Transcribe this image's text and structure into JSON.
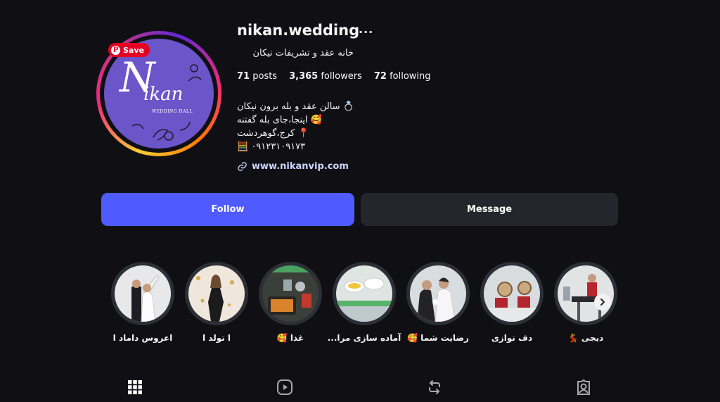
{
  "save_button": {
    "label": "Save"
  },
  "profile": {
    "username": "nikan.wedding",
    "category": "خانه عقد و تشریفات نیکان",
    "posts_count": "71",
    "posts_label": "posts",
    "followers_count": "3,365",
    "followers_label": "followers",
    "following_count": "72",
    "following_label": "following",
    "bio": [
      "💍 سالن عقد و بله برون نیکان",
      "🥰 اینجا،جای بله گفتنه",
      "📍 کرج،گوهردشت",
      "🧮 ۰۹۱۲۳۱۰۹۱۷۳"
    ],
    "link": "www.nikanvip.com"
  },
  "avatar_logo": {
    "big": "N",
    "word": "ikan",
    "sub": "WEDDING HALL"
  },
  "actions": {
    "follow": "Follow",
    "message": "Message"
  },
  "highlights": [
    {
      "label": "اعروس داماد ا",
      "icon": "bride-groom-photo"
    },
    {
      "label": "ا تولد ا",
      "icon": "birthday-photo"
    },
    {
      "label": "غذا 🥰",
      "icon": "food-photo"
    },
    {
      "label": "آماده سازی مرا...",
      "icon": "preparation-photo"
    },
    {
      "label": "رضایت شما 🥰",
      "icon": "couple-photo"
    },
    {
      "label": "دف نوازی",
      "icon": "daf-photo"
    },
    {
      "label": "دیجی 💃",
      "icon": "dj-photo"
    }
  ],
  "tabs": [
    {
      "name": "posts",
      "icon": "grid-icon",
      "active": true
    },
    {
      "name": "reels",
      "icon": "reels-icon",
      "active": false
    },
    {
      "name": "reposts",
      "icon": "repost-icon",
      "active": false
    },
    {
      "name": "tagged",
      "icon": "tagged-icon",
      "active": false
    }
  ],
  "colors": {
    "background": "#101014",
    "follow_button": "#4f5bff",
    "message_button": "#25262c",
    "link": "#c9d6ff",
    "pinterest_red": "#e60023"
  }
}
